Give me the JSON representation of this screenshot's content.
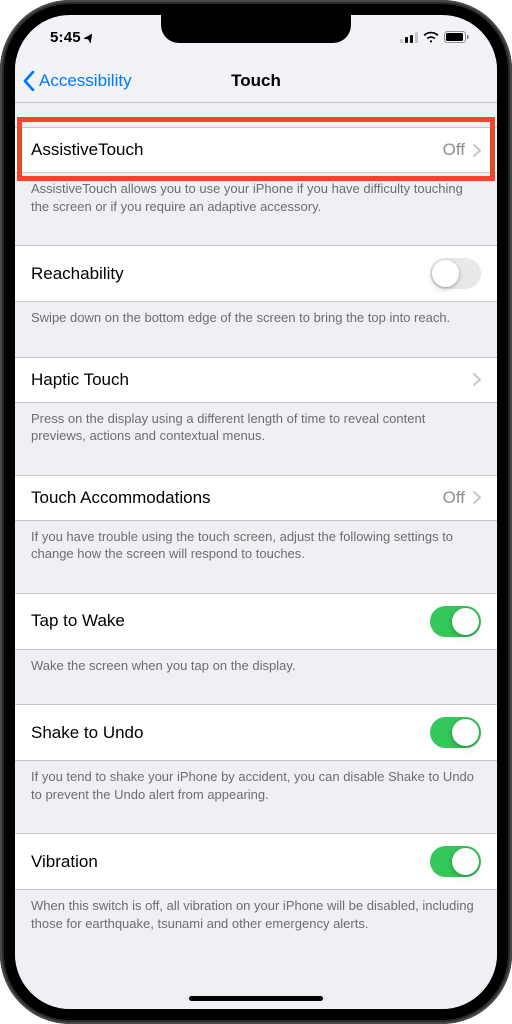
{
  "status": {
    "time": "5:45"
  },
  "nav": {
    "back": "Accessibility",
    "title": "Touch"
  },
  "rows": {
    "assistive": {
      "label": "AssistiveTouch",
      "value": "Off",
      "desc": "AssistiveTouch allows you to use your iPhone if you have difficulty touching the screen or if you require an adaptive accessory."
    },
    "reachability": {
      "label": "Reachability",
      "desc": "Swipe down on the bottom edge of the screen to bring the top into reach."
    },
    "haptic": {
      "label": "Haptic Touch",
      "desc": "Press on the display using a different length of time to reveal content previews, actions and contextual menus."
    },
    "accommodations": {
      "label": "Touch Accommodations",
      "value": "Off",
      "desc": "If you have trouble using the touch screen, adjust the following settings to change how the screen will respond to touches."
    },
    "tapwake": {
      "label": "Tap to Wake",
      "desc": "Wake the screen when you tap on the display."
    },
    "shake": {
      "label": "Shake to Undo",
      "desc": "If you tend to shake your iPhone by accident, you can disable Shake to Undo to prevent the Undo alert from appearing."
    },
    "vibration": {
      "label": "Vibration",
      "desc": "When this switch is off, all vibration on your iPhone will be disabled, including those for earthquake, tsunami and other emergency alerts."
    }
  }
}
